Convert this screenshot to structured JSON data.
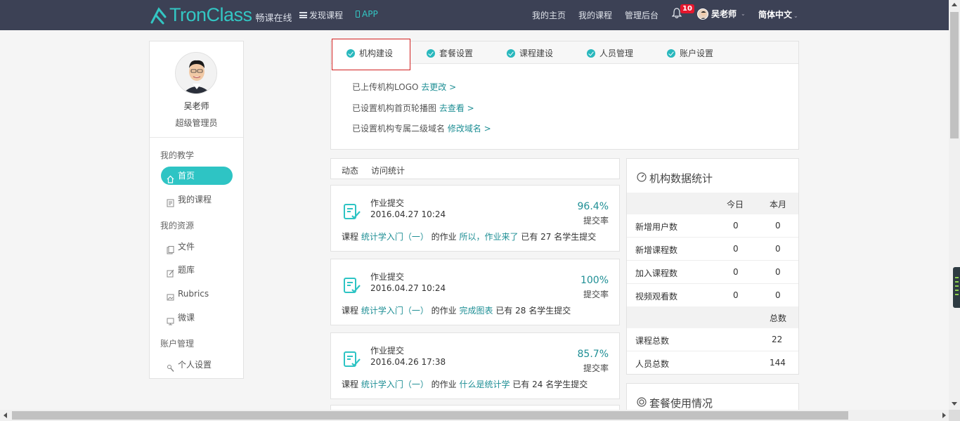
{
  "nav": {
    "logo_text": "TronClass",
    "logo_sub": "畅课在线",
    "discover": "发现课程",
    "app": "APP",
    "my_home": "我的主页",
    "my_courses": "我的课程",
    "admin": "管理后台",
    "notification_count": "10",
    "user_name": "吴老师",
    "language": "简体中文",
    "accent": "#33c6c3",
    "bar_color": "#3c4155"
  },
  "sidebar": {
    "name": "吴老师",
    "role": "超级管理员",
    "sec_teaching": "我的教学",
    "home": "首页",
    "courses": "我的课程",
    "sec_resources": "我的资源",
    "files": "文件",
    "question_bank": "题库",
    "rubrics": "Rubrics",
    "micro": "微课",
    "sec_account": "账户管理",
    "personal": "个人设置"
  },
  "tabs": [
    "机构建设",
    "套餐设置",
    "课程建设",
    "人员管理",
    "账户设置"
  ],
  "tasks": [
    {
      "text": "已上传机构LOGO",
      "link": "去更改 >"
    },
    {
      "text": "已设置机构首页轮播图",
      "link": "去查看 >"
    },
    {
      "text": "已设置机构专属二级域名",
      "link": "修改域名 >"
    }
  ],
  "activity_tabs": [
    "动态",
    "访问统计"
  ],
  "activities": [
    {
      "title": "作业提交",
      "time": "2016.04.27 10:24",
      "pct": "96.4%",
      "label": "提交率",
      "pre": "课程 ",
      "course": "统计学入门（一）",
      "mid": " 的作业 ",
      "hw": "所以，作业来了",
      "post": " 已有 27 名学生提交"
    },
    {
      "title": "作业提交",
      "time": "2016.04.27 10:24",
      "pct": "100%",
      "label": "提交率",
      "pre": "课程 ",
      "course": "统计学入门（一）",
      "mid": " 的作业 ",
      "hw": "完成图表",
      "post": " 已有 28 名学生提交"
    },
    {
      "title": "作业提交",
      "time": "2016.04.26 17:38",
      "pct": "85.7%",
      "label": "提交率",
      "pre": "课程 ",
      "course": "统计学入门（一）",
      "mid": " 的作业 ",
      "hw": "什么是统计学",
      "post": " 已有 24 名学生提交"
    }
  ],
  "stats": {
    "title": "机构数据统计",
    "col_today": "今日",
    "col_month": "本月",
    "rows": [
      {
        "label": "新增用户数",
        "today": "0",
        "month": "0"
      },
      {
        "label": "新增课程数",
        "today": "0",
        "month": "0"
      },
      {
        "label": "加入课程数",
        "today": "0",
        "month": "0"
      },
      {
        "label": "视频观看数",
        "today": "0",
        "month": "0"
      }
    ],
    "col_total": "总数",
    "totals": [
      {
        "label": "课程总数",
        "value": "22"
      },
      {
        "label": "人员总数",
        "value": "144"
      }
    ]
  },
  "package": {
    "title": "套餐使用情况"
  }
}
